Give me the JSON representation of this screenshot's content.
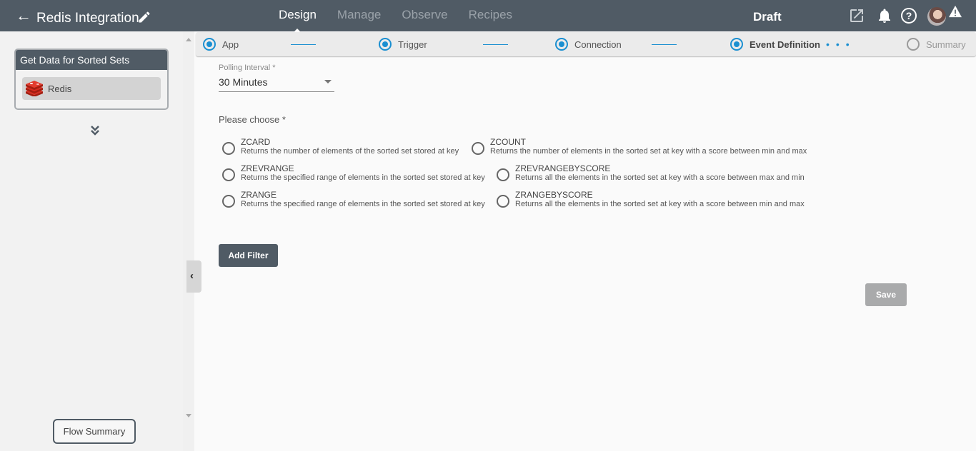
{
  "header": {
    "back_icon": "arrow-left-icon",
    "title": "Redis Integration",
    "edit_icon": "pencil-icon",
    "nav": [
      {
        "label": "Design",
        "active": true
      },
      {
        "label": "Manage",
        "active": false
      },
      {
        "label": "Observe",
        "active": false
      },
      {
        "label": "Recipes",
        "active": false
      }
    ],
    "status": "Draft",
    "icons": [
      "external-link-icon",
      "bell-icon",
      "help-icon",
      "avatar",
      "warning-icon"
    ]
  },
  "sidebar": {
    "card_title": "Get Data for Sorted Sets",
    "card_item": "Redis",
    "flow_summary_label": "Flow Summary"
  },
  "stepper": {
    "steps": [
      {
        "label": "App",
        "state": "done"
      },
      {
        "label": "Trigger",
        "state": "done"
      },
      {
        "label": "Connection",
        "state": "done"
      },
      {
        "label": "Event Definition",
        "state": "current"
      },
      {
        "label": "Summary",
        "state": "pending"
      }
    ]
  },
  "form": {
    "polling_label": "Polling Interval *",
    "polling_value": "30 Minutes",
    "choose_label": "Please choose *",
    "options": [
      {
        "name": "ZCARD",
        "desc": "Returns the number of elements of the sorted set stored at key",
        "selected": false
      },
      {
        "name": "ZCOUNT",
        "desc": "Returns the number of elements in the sorted set at key with a score between min and max",
        "selected": false
      },
      {
        "name": "ZREVRANGE",
        "desc": "Returns the specified range of elements in the sorted set stored at key",
        "selected": false
      },
      {
        "name": "ZREVRANGEBYSCORE",
        "desc": "Returns all the elements in the sorted set at key with a score between max and min",
        "selected": false
      },
      {
        "name": "ZRANGE",
        "desc": "Returns the specified range of elements in the sorted set stored at key",
        "selected": false
      },
      {
        "name": "ZRANGEBYSCORE",
        "desc": "Returns all the elements in the sorted set at key with a score between min and max",
        "selected": false
      }
    ],
    "add_filter_label": "Add Filter",
    "save_label": "Save"
  }
}
